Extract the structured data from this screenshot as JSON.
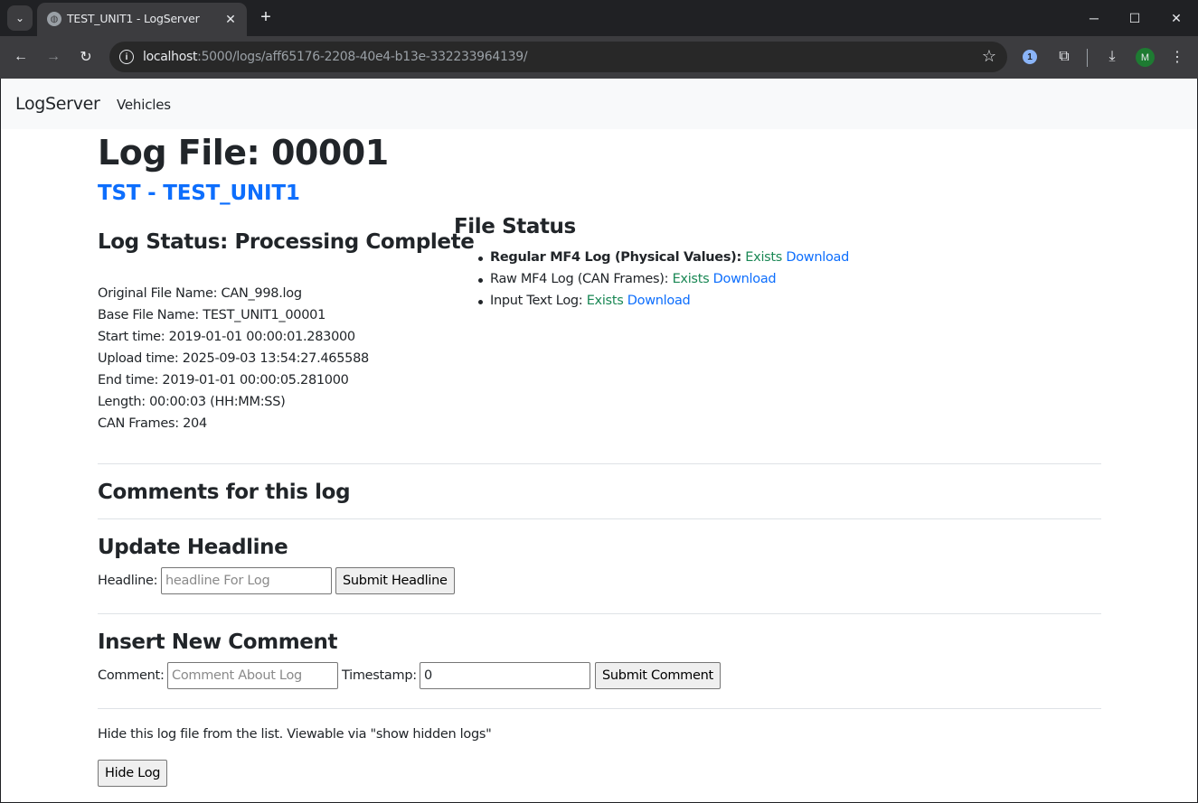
{
  "browser": {
    "tab_title": "TEST_UNIT1 - LogServer",
    "url_host": "localhost",
    "url_path": ":5000/logs/aff65176-2208-40e4-b13e-332233964139/",
    "avatar_letter": "M",
    "icons": [
      "tab-search-icon",
      "globe-icon",
      "close-icon",
      "plus-icon",
      "minimize-icon",
      "maximize-icon",
      "close-window-icon",
      "back-icon",
      "forward-icon",
      "reload-icon",
      "info-icon",
      "star-icon",
      "password-manager-icon",
      "extensions-icon",
      "download-icon",
      "menu-icon"
    ]
  },
  "navbar": {
    "brand": "LogServer",
    "links": [
      "Vehicles"
    ]
  },
  "page": {
    "title": "Log File: 00001",
    "unit_link": "TST - TEST_UNIT1",
    "status_heading": "Log Status: Processing Complete",
    "info": [
      "Original File Name: CAN_998.log",
      "Base File Name: TEST_UNIT1_00001",
      "Start time: 2019-01-01 00:00:01.283000",
      "Upload time: 2025-09-03 13:54:27.465588",
      "End time: 2019-01-01 00:00:05.281000",
      "Length: 00:00:03 (HH:MM:SS)",
      "CAN Frames: 204"
    ],
    "file_status_heading": "File Status",
    "files": [
      {
        "label": "Regular MF4 Log (Physical Values):",
        "status": "Exists",
        "link": "Download"
      },
      {
        "label": "Raw MF4 Log (CAN Frames):",
        "status": "Exists",
        "link": "Download"
      },
      {
        "label": "Input Text Log:",
        "status": "Exists",
        "link": "Download"
      }
    ],
    "comments_heading": "Comments for this log",
    "headline": {
      "heading": "Update Headline",
      "label": "Headline:",
      "placeholder": "headline For Log",
      "button": "Submit Headline"
    },
    "comment": {
      "heading": "Insert New Comment",
      "label": "Comment:",
      "placeholder": "Comment About Log",
      "timestamp_label": "Timestamp:",
      "timestamp_value": "0",
      "button": "Submit Comment"
    },
    "hide": {
      "text": "Hide this log file from the list. Viewable via \"show hidden logs\"",
      "button": "Hide Log"
    }
  },
  "colors": {
    "link": "#0d6efd",
    "exists": "#198754",
    "navbar_bg": "#f8f9fa",
    "chrome_dark": "#202124"
  }
}
